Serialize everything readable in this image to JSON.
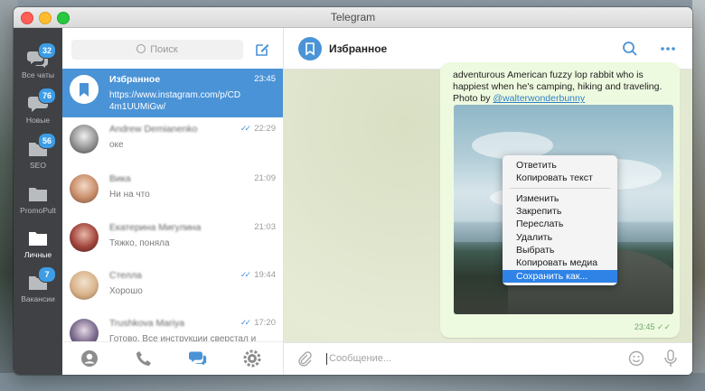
{
  "window": {
    "title": "Telegram"
  },
  "folders": [
    {
      "label": "Все чаты",
      "badge": "32",
      "icon": "chat-bubbles-icon",
      "active": false
    },
    {
      "label": "Новые",
      "badge": "76",
      "icon": "chat-bubble-icon",
      "active": false
    },
    {
      "label": "SEO",
      "badge": "56",
      "icon": "folder-icon",
      "active": false
    },
    {
      "label": "PromoPult",
      "badge": "",
      "icon": "folder-icon",
      "active": false
    },
    {
      "label": "Личные",
      "badge": "",
      "icon": "folder-icon",
      "active": true
    },
    {
      "label": "Вакансии",
      "badge": "7",
      "icon": "folder-icon",
      "active": false
    }
  ],
  "search": {
    "placeholder": "Поиск"
  },
  "chats": [
    {
      "name": "Избранное",
      "time": "23:45",
      "message": "https://www.instagram.com/p/CD4m1UUMiGw/",
      "read": false,
      "active": true
    },
    {
      "name": "Andrew Demianenko",
      "time": "22:29",
      "message": "оке",
      "read": true
    },
    {
      "name": "Вика",
      "time": "21:09",
      "message": "Ни на что",
      "read": false
    },
    {
      "name": "Екатерина Мигулина",
      "time": "21:03",
      "message": "Тяжко, поняла",
      "read": false
    },
    {
      "name": "Стелла",
      "time": "19:44",
      "message": "Хорошо",
      "read": true
    },
    {
      "name": "Trushkova Mariya",
      "time": "17:20",
      "message": "Готово. Все инструкции сверстал и сохранил в черновик. Все ссылки п...",
      "read": true
    }
  ],
  "bottom_nav": [
    "contacts-icon",
    "calls-icon",
    "chats-icon",
    "settings-icon"
  ],
  "chat_header": {
    "title": "Избранное"
  },
  "message": {
    "caption": "adventurous American fuzzy lop rabbit who is happiest when he's camping, hiking and traveling. Photo by",
    "link": "@walterwonderbunny",
    "time": "23:45"
  },
  "context_menu": [
    {
      "label": "Ответить",
      "selected": false
    },
    {
      "label": "Копировать текст",
      "selected": false
    },
    {
      "label": "Изменить",
      "selected": false
    },
    {
      "label": "Закрепить",
      "selected": false
    },
    {
      "label": "Переслать",
      "selected": false
    },
    {
      "label": "Удалить",
      "selected": false
    },
    {
      "label": "Выбрать",
      "selected": false
    },
    {
      "label": "Копировать медиа",
      "selected": false
    },
    {
      "label": "Сохранить как...",
      "selected": true
    }
  ],
  "composer": {
    "placeholder": "Сообщение..."
  },
  "colors": {
    "accent": "#4a93d6",
    "sidebar": "#3f4144",
    "bubble": "#eefadf",
    "menu_highlight": "#2f82e6"
  }
}
